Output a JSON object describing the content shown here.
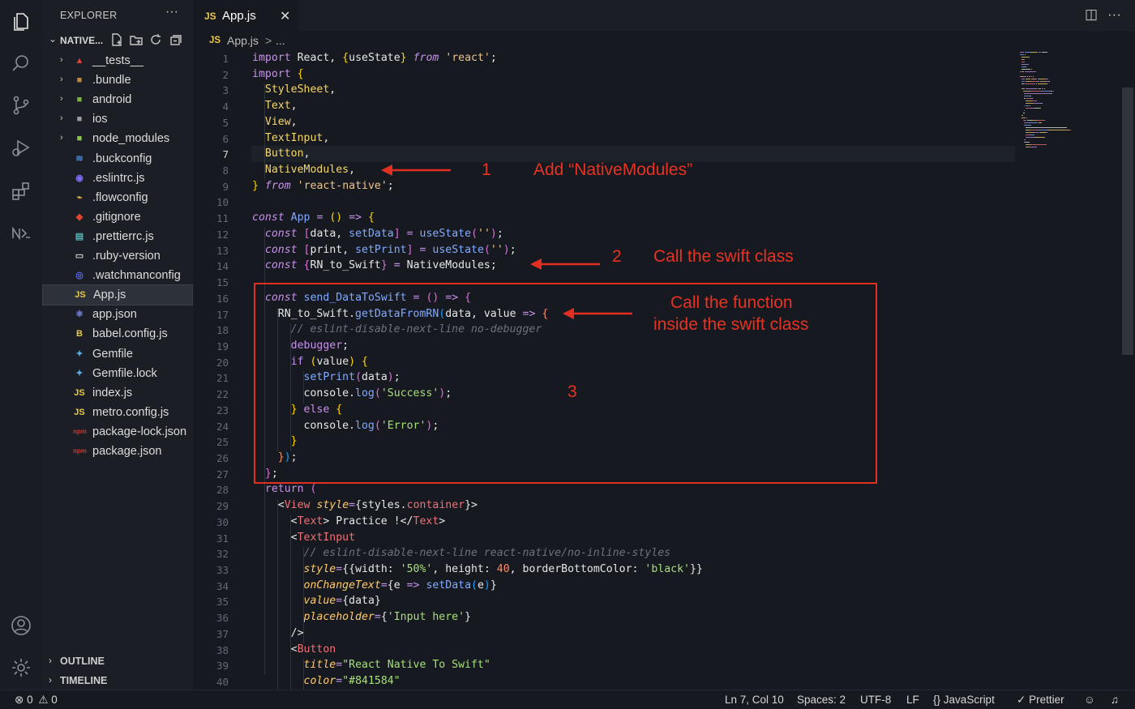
{
  "sidebar": {
    "header": "EXPLORER",
    "more": "···",
    "project": "NATIVE...",
    "items": [
      {
        "label": "__tests__",
        "icon": "tests-folder-icon",
        "glyph": "▲",
        "color": "#e0423a",
        "folder": true
      },
      {
        "label": ".bundle",
        "icon": "folder-icon",
        "glyph": "■",
        "color": "#c08a3e",
        "folder": true
      },
      {
        "label": "android",
        "icon": "android-folder-icon",
        "glyph": "■",
        "color": "#7cb342",
        "folder": true
      },
      {
        "label": "ios",
        "icon": "ios-folder-icon",
        "glyph": "■",
        "color": "#9e9e9e",
        "folder": true
      },
      {
        "label": "node_modules",
        "icon": "node-modules-folder-icon",
        "glyph": "■",
        "color": "#8bc34a",
        "folder": true
      },
      {
        "label": ".buckconfig",
        "icon": "buck-icon",
        "glyph": "≋",
        "color": "#4f8ad9",
        "folder": false
      },
      {
        "label": ".eslintrc.js",
        "icon": "eslint-icon",
        "glyph": "◉",
        "color": "#7b6cf0",
        "folder": false
      },
      {
        "label": ".flowconfig",
        "icon": "flow-icon",
        "glyph": "⌁",
        "color": "#e8b93c",
        "folder": false
      },
      {
        "label": ".gitignore",
        "icon": "git-icon",
        "glyph": "◆",
        "color": "#e2462c",
        "folder": false
      },
      {
        "label": ".prettierrc.js",
        "icon": "prettier-icon",
        "glyph": "▤",
        "color": "#56b3b4",
        "folder": false
      },
      {
        "label": ".ruby-version",
        "icon": "file-icon",
        "glyph": "▭",
        "color": "#c8c8c8",
        "folder": false
      },
      {
        "label": ".watchmanconfig",
        "icon": "watchman-icon",
        "glyph": "◎",
        "color": "#5b6cf0",
        "folder": false
      },
      {
        "label": "App.js",
        "icon": "javascript-icon",
        "glyph": "JS",
        "color": "#e8c94a",
        "folder": false,
        "selected": true
      },
      {
        "label": "app.json",
        "icon": "react-icon",
        "glyph": "⚛",
        "color": "#7b8cf0",
        "folder": false
      },
      {
        "label": "babel.config.js",
        "icon": "babel-icon",
        "glyph": "B",
        "color": "#e8c94a",
        "folder": false
      },
      {
        "label": "Gemfile",
        "icon": "gemfile-icon",
        "glyph": "✦",
        "color": "#5aa9e6",
        "folder": false
      },
      {
        "label": "Gemfile.lock",
        "icon": "gemfile-lock-icon",
        "glyph": "✦",
        "color": "#5aa9e6",
        "folder": false
      },
      {
        "label": "index.js",
        "icon": "javascript-icon",
        "glyph": "JS",
        "color": "#e8c94a",
        "folder": false
      },
      {
        "label": "metro.config.js",
        "icon": "javascript-icon",
        "glyph": "JS",
        "color": "#e8c94a",
        "folder": false
      },
      {
        "label": "package-lock.json",
        "icon": "npm-icon",
        "glyph": "npm",
        "color": "#cb3837",
        "folder": false
      },
      {
        "label": "package.json",
        "icon": "npm-icon",
        "glyph": "npm",
        "color": "#cb3837",
        "folder": false
      }
    ],
    "panels": [
      "OUTLINE",
      "TIMELINE"
    ]
  },
  "tab": {
    "lang": "JS",
    "name": "App.js",
    "close": "✕"
  },
  "breadcrumb": {
    "lang": "JS",
    "file": "App.js",
    "sep": ">",
    "rest": "..."
  },
  "editor": {
    "active_line": 7,
    "lines": [
      [
        [
          "k",
          "import"
        ],
        [
          "w",
          " React, "
        ],
        [
          "p1",
          "{"
        ],
        [
          "w",
          "useState"
        ],
        [
          "p1",
          "}"
        ],
        [
          "w",
          " "
        ],
        [
          "ki",
          "from"
        ],
        [
          "w",
          " "
        ],
        [
          "s",
          "'react'"
        ],
        [
          "w",
          ";"
        ]
      ],
      [
        [
          "k",
          "import"
        ],
        [
          "w",
          " "
        ],
        [
          "p1",
          "{"
        ]
      ],
      [
        [
          "w",
          "  "
        ],
        [
          "y",
          "StyleSheet"
        ],
        [
          "w",
          ","
        ]
      ],
      [
        [
          "w",
          "  "
        ],
        [
          "y",
          "Text"
        ],
        [
          "w",
          ","
        ]
      ],
      [
        [
          "w",
          "  "
        ],
        [
          "y",
          "View"
        ],
        [
          "w",
          ","
        ]
      ],
      [
        [
          "w",
          "  "
        ],
        [
          "y",
          "TextInput"
        ],
        [
          "w",
          ","
        ]
      ],
      [
        [
          "w",
          "  "
        ],
        [
          "y",
          "Button"
        ],
        [
          "w",
          ","
        ]
      ],
      [
        [
          "w",
          "  "
        ],
        [
          "y",
          "NativeModules"
        ],
        [
          "w",
          ","
        ]
      ],
      [
        [
          "p1",
          "}"
        ],
        [
          "w",
          " "
        ],
        [
          "ki",
          "from"
        ],
        [
          "w",
          " "
        ],
        [
          "s",
          "'react-native'"
        ],
        [
          "w",
          ";"
        ]
      ],
      [],
      [
        [
          "ki",
          "const"
        ],
        [
          "w",
          " "
        ],
        [
          "f",
          "App"
        ],
        [
          "w",
          " "
        ],
        [
          "o",
          "="
        ],
        [
          "w",
          " "
        ],
        [
          "p1",
          "()"
        ],
        [
          "w",
          " "
        ],
        [
          "o",
          "=>"
        ],
        [
          "w",
          " "
        ],
        [
          "p1",
          "{"
        ]
      ],
      [
        [
          "w",
          "  "
        ],
        [
          "ki",
          "const"
        ],
        [
          "w",
          " "
        ],
        [
          "p2",
          "["
        ],
        [
          "w",
          "data, "
        ],
        [
          "f",
          "setData"
        ],
        [
          "p2",
          "]"
        ],
        [
          "w",
          " "
        ],
        [
          "o",
          "="
        ],
        [
          "w",
          " "
        ],
        [
          "f",
          "useState"
        ],
        [
          "p2",
          "("
        ],
        [
          "s",
          "''"
        ],
        [
          "p2",
          ")"
        ],
        [
          "w",
          ";"
        ]
      ],
      [
        [
          "w",
          "  "
        ],
        [
          "ki",
          "const"
        ],
        [
          "w",
          " "
        ],
        [
          "p2",
          "["
        ],
        [
          "w",
          "print, "
        ],
        [
          "f",
          "setPrint"
        ],
        [
          "p2",
          "]"
        ],
        [
          "w",
          " "
        ],
        [
          "o",
          "="
        ],
        [
          "w",
          " "
        ],
        [
          "f",
          "useState"
        ],
        [
          "p2",
          "("
        ],
        [
          "s",
          "''"
        ],
        [
          "p2",
          ")"
        ],
        [
          "w",
          ";"
        ]
      ],
      [
        [
          "w",
          "  "
        ],
        [
          "ki",
          "const"
        ],
        [
          "w",
          " "
        ],
        [
          "p2",
          "{"
        ],
        [
          "w",
          "RN_to_Swift"
        ],
        [
          "p2",
          "}"
        ],
        [
          "w",
          " "
        ],
        [
          "o",
          "="
        ],
        [
          "w",
          " NativeModules;"
        ]
      ],
      [],
      [
        [
          "w",
          "  "
        ],
        [
          "ki",
          "const"
        ],
        [
          "w",
          " "
        ],
        [
          "f",
          "send_DataToSwift"
        ],
        [
          "w",
          " "
        ],
        [
          "o",
          "="
        ],
        [
          "w",
          " "
        ],
        [
          "p2",
          "()"
        ],
        [
          "w",
          " "
        ],
        [
          "o",
          "=>"
        ],
        [
          "w",
          " "
        ],
        [
          "p2",
          "{"
        ]
      ],
      [
        [
          "w",
          "    RN_to_Swift."
        ],
        [
          "f",
          "getDataFromRN"
        ],
        [
          "p3",
          "("
        ],
        [
          "w",
          "data, value "
        ],
        [
          "o",
          "=>"
        ],
        [
          "w",
          " "
        ],
        [
          "n",
          "{"
        ]
      ],
      [
        [
          "w",
          "      "
        ],
        [
          "c",
          "// eslint-disable-next-line no-debugger"
        ]
      ],
      [
        [
          "w",
          "      "
        ],
        [
          "k",
          "debugger"
        ],
        [
          "w",
          ";"
        ]
      ],
      [
        [
          "w",
          "      "
        ],
        [
          "k",
          "if"
        ],
        [
          "w",
          " "
        ],
        [
          "p1",
          "("
        ],
        [
          "w",
          "value"
        ],
        [
          "p1",
          ")"
        ],
        [
          "w",
          " "
        ],
        [
          "p1",
          "{"
        ]
      ],
      [
        [
          "w",
          "        "
        ],
        [
          "f",
          "setPrint"
        ],
        [
          "p2",
          "("
        ],
        [
          "w",
          "data"
        ],
        [
          "p2",
          ")"
        ],
        [
          "w",
          ";"
        ]
      ],
      [
        [
          "w",
          "        console."
        ],
        [
          "f",
          "log"
        ],
        [
          "p2",
          "("
        ],
        [
          "st",
          "'Success'"
        ],
        [
          "p2",
          ")"
        ],
        [
          "w",
          ";"
        ]
      ],
      [
        [
          "w",
          "      "
        ],
        [
          "p1",
          "}"
        ],
        [
          "w",
          " "
        ],
        [
          "k",
          "else"
        ],
        [
          "w",
          " "
        ],
        [
          "p1",
          "{"
        ]
      ],
      [
        [
          "w",
          "        console."
        ],
        [
          "f",
          "log"
        ],
        [
          "p2",
          "("
        ],
        [
          "st",
          "'Error'"
        ],
        [
          "p2",
          ")"
        ],
        [
          "w",
          ";"
        ]
      ],
      [
        [
          "w",
          "      "
        ],
        [
          "p1",
          "}"
        ]
      ],
      [
        [
          "w",
          "    "
        ],
        [
          "n",
          "}"
        ],
        [
          "p3",
          ")"
        ],
        [
          "w",
          ";"
        ]
      ],
      [
        [
          "w",
          "  "
        ],
        [
          "p2",
          "}"
        ],
        [
          "w",
          ";"
        ]
      ],
      [
        [
          "w",
          "  "
        ],
        [
          "k",
          "return"
        ],
        [
          "w",
          " "
        ],
        [
          "p2",
          "("
        ]
      ],
      [
        [
          "w",
          "    "
        ],
        [
          "w",
          "<"
        ],
        [
          "t",
          "View"
        ],
        [
          "w",
          " "
        ],
        [
          "a",
          "style"
        ],
        [
          "o",
          "="
        ],
        [
          "w",
          "{styles."
        ],
        [
          "t",
          "container"
        ],
        [
          "w",
          "}>"
        ]
      ],
      [
        [
          "w",
          "      <"
        ],
        [
          "t",
          "Text"
        ],
        [
          "w",
          "> Practice !</"
        ],
        [
          "t",
          "Text"
        ],
        [
          "w",
          ">"
        ]
      ],
      [
        [
          "w",
          "      <"
        ],
        [
          "t",
          "TextInput"
        ]
      ],
      [
        [
          "w",
          "        "
        ],
        [
          "c",
          "// eslint-disable-next-line react-native/no-inline-styles"
        ]
      ],
      [
        [
          "w",
          "        "
        ],
        [
          "a",
          "style"
        ],
        [
          "o",
          "="
        ],
        [
          "w",
          "{{width: "
        ],
        [
          "st",
          "'50%'"
        ],
        [
          "w",
          ", height: "
        ],
        [
          "n",
          "40"
        ],
        [
          "w",
          ", borderBottomColor: "
        ],
        [
          "st",
          "'black'"
        ],
        [
          "w",
          "}}"
        ]
      ],
      [
        [
          "w",
          "        "
        ],
        [
          "a",
          "onChangeText"
        ],
        [
          "o",
          "="
        ],
        [
          "w",
          "{e "
        ],
        [
          "o",
          "=>"
        ],
        [
          "w",
          " "
        ],
        [
          "f",
          "setData"
        ],
        [
          "p3",
          "("
        ],
        [
          "w",
          "e"
        ],
        [
          "p3",
          ")"
        ],
        [
          "w",
          "}"
        ]
      ],
      [
        [
          "w",
          "        "
        ],
        [
          "a",
          "value"
        ],
        [
          "o",
          "="
        ],
        [
          "w",
          "{data}"
        ]
      ],
      [
        [
          "w",
          "        "
        ],
        [
          "a",
          "placeholder"
        ],
        [
          "o",
          "="
        ],
        [
          "w",
          "{"
        ],
        [
          "st",
          "'Input here'"
        ],
        [
          "w",
          "}"
        ]
      ],
      [
        [
          "w",
          "      />"
        ]
      ],
      [
        [
          "w",
          "      <"
        ],
        [
          "t",
          "Button"
        ]
      ],
      [
        [
          "w",
          "        "
        ],
        [
          "a",
          "title"
        ],
        [
          "o",
          "="
        ],
        [
          "st",
          "\"React Native To Swift\""
        ]
      ],
      [
        [
          "w",
          "        "
        ],
        [
          "a",
          "color"
        ],
        [
          "o",
          "="
        ],
        [
          "st",
          "\"#841584\""
        ]
      ]
    ]
  },
  "annotations": {
    "a1_num": "1",
    "a1_text": "Add “NativeModules”",
    "a2_num": "2",
    "a2_text": "Call the swift class",
    "a3_line1": "Call the function",
    "a3_line2": "inside the swift class",
    "a3_num": "3"
  },
  "status": {
    "errors": "0",
    "warnings": "0",
    "position": "Ln 7, Col 10",
    "spaces": "Spaces: 2",
    "encoding": "UTF-8",
    "eol": "LF",
    "language_braces": "{}",
    "language": "JavaScript",
    "prettier": "Prettier"
  },
  "colors": {
    "accent_red": "#e63323",
    "js_yellow": "#e8c94a",
    "background": "#16191f"
  }
}
